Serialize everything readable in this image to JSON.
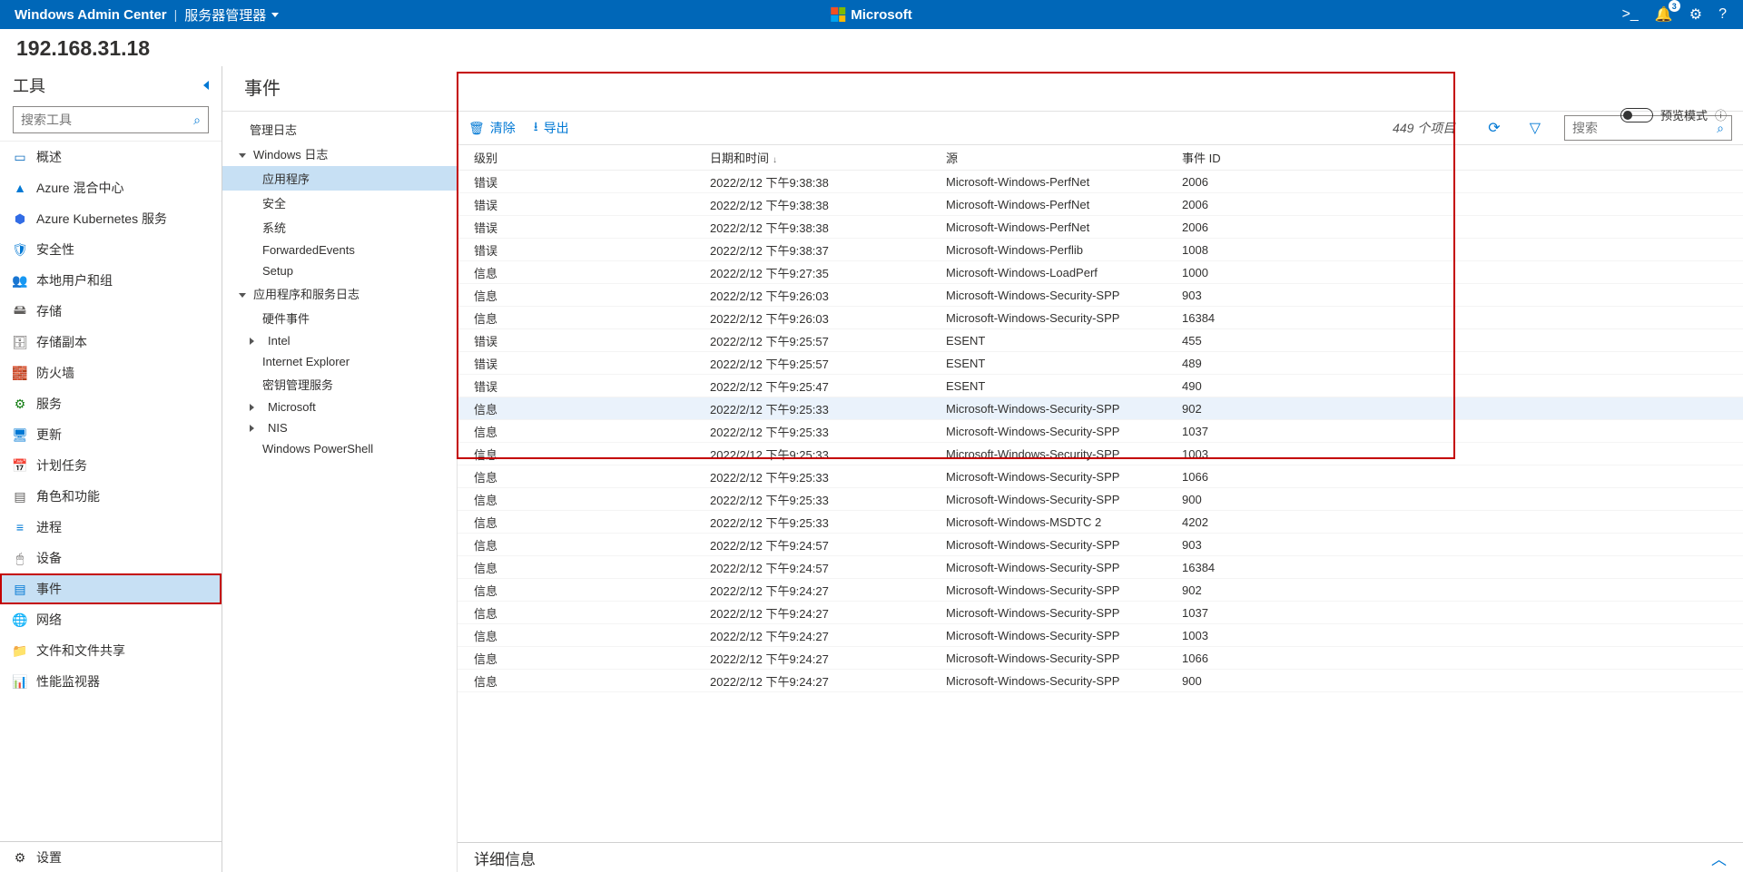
{
  "topbar": {
    "brand": "Windows Admin Center",
    "scope": "服务器管理器",
    "ms": "Microsoft",
    "notif_count": "3"
  },
  "connection": "192.168.31.18",
  "tools": {
    "header": "工具",
    "search_placeholder": "搜索工具",
    "items": [
      {
        "label": "概述",
        "icon": "overview",
        "color": "#106ebe"
      },
      {
        "label": "Azure 混合中心",
        "icon": "azure",
        "color": "#0078d4"
      },
      {
        "label": "Azure Kubernetes 服务",
        "icon": "aks",
        "color": "#326ce5"
      },
      {
        "label": "安全性",
        "icon": "shield",
        "color": "#0078d4"
      },
      {
        "label": "本地用户和组",
        "icon": "users",
        "color": "#d83b01"
      },
      {
        "label": "存储",
        "icon": "storage",
        "color": "#605e5c"
      },
      {
        "label": "存储副本",
        "icon": "replica",
        "color": "#605e5c"
      },
      {
        "label": "防火墙",
        "icon": "firewall",
        "color": "#d13438"
      },
      {
        "label": "服务",
        "icon": "services",
        "color": "#107c10"
      },
      {
        "label": "更新",
        "icon": "update",
        "color": "#0078d4"
      },
      {
        "label": "计划任务",
        "icon": "tasks",
        "color": "#5c2e91"
      },
      {
        "label": "角色和功能",
        "icon": "roles",
        "color": "#605e5c"
      },
      {
        "label": "进程",
        "icon": "process",
        "color": "#0078d4"
      },
      {
        "label": "设备",
        "icon": "devices",
        "color": "#605e5c"
      },
      {
        "label": "事件",
        "icon": "events",
        "color": "#0078d4",
        "selected": true
      },
      {
        "label": "网络",
        "icon": "network",
        "color": "#107c10"
      },
      {
        "label": "文件和文件共享",
        "icon": "files",
        "color": "#ffb900"
      },
      {
        "label": "性能监视器",
        "icon": "perf",
        "color": "#0078d4"
      }
    ],
    "footer": {
      "label": "设置",
      "icon": "gear",
      "color": "#605e5c"
    }
  },
  "main": {
    "title": "事件",
    "preview_label": "预览模式",
    "tree": {
      "root": "管理日志",
      "groups": [
        {
          "label": "Windows 日志",
          "expanded": true,
          "children": [
            {
              "label": "应用程序",
              "selected": true
            },
            {
              "label": "安全"
            },
            {
              "label": "系统"
            },
            {
              "label": "ForwardedEvents"
            },
            {
              "label": "Setup"
            }
          ]
        },
        {
          "label": "应用程序和服务日志",
          "expanded": true,
          "children": [
            {
              "label": "硬件事件"
            },
            {
              "label": "Intel",
              "hasChildren": true
            },
            {
              "label": "Internet Explorer"
            },
            {
              "label": "密钥管理服务"
            },
            {
              "label": "Microsoft",
              "hasChildren": true
            },
            {
              "label": "NIS",
              "hasChildren": true
            },
            {
              "label": "Windows PowerShell"
            }
          ]
        }
      ]
    },
    "cmd": {
      "clear": "清除",
      "export": "导出",
      "items_text": "449 个项目",
      "search_placeholder": "搜索"
    },
    "columns": {
      "level": "级别",
      "datetime": "日期和时间",
      "source": "源",
      "id": "事件 ID"
    },
    "rows": [
      {
        "level": "错误",
        "dt": "2022/2/12 下午9:38:38",
        "src": "Microsoft-Windows-PerfNet",
        "id": "2006"
      },
      {
        "level": "错误",
        "dt": "2022/2/12 下午9:38:38",
        "src": "Microsoft-Windows-PerfNet",
        "id": "2006"
      },
      {
        "level": "错误",
        "dt": "2022/2/12 下午9:38:38",
        "src": "Microsoft-Windows-PerfNet",
        "id": "2006"
      },
      {
        "level": "错误",
        "dt": "2022/2/12 下午9:38:37",
        "src": "Microsoft-Windows-Perflib",
        "id": "1008"
      },
      {
        "level": "信息",
        "dt": "2022/2/12 下午9:27:35",
        "src": "Microsoft-Windows-LoadPerf",
        "id": "1000"
      },
      {
        "level": "信息",
        "dt": "2022/2/12 下午9:26:03",
        "src": "Microsoft-Windows-Security-SPP",
        "id": "903"
      },
      {
        "level": "信息",
        "dt": "2022/2/12 下午9:26:03",
        "src": "Microsoft-Windows-Security-SPP",
        "id": "16384"
      },
      {
        "level": "错误",
        "dt": "2022/2/12 下午9:25:57",
        "src": "ESENT",
        "id": "455"
      },
      {
        "level": "错误",
        "dt": "2022/2/12 下午9:25:57",
        "src": "ESENT",
        "id": "489"
      },
      {
        "level": "错误",
        "dt": "2022/2/12 下午9:25:47",
        "src": "ESENT",
        "id": "490"
      },
      {
        "level": "信息",
        "dt": "2022/2/12 下午9:25:33",
        "src": "Microsoft-Windows-Security-SPP",
        "id": "902",
        "sel": true
      },
      {
        "level": "信息",
        "dt": "2022/2/12 下午9:25:33",
        "src": "Microsoft-Windows-Security-SPP",
        "id": "1037"
      },
      {
        "level": "信息",
        "dt": "2022/2/12 下午9:25:33",
        "src": "Microsoft-Windows-Security-SPP",
        "id": "1003"
      },
      {
        "level": "信息",
        "dt": "2022/2/12 下午9:25:33",
        "src": "Microsoft-Windows-Security-SPP",
        "id": "1066"
      },
      {
        "level": "信息",
        "dt": "2022/2/12 下午9:25:33",
        "src": "Microsoft-Windows-Security-SPP",
        "id": "900"
      },
      {
        "level": "信息",
        "dt": "2022/2/12 下午9:25:33",
        "src": "Microsoft-Windows-MSDTC 2",
        "id": "4202"
      },
      {
        "level": "信息",
        "dt": "2022/2/12 下午9:24:57",
        "src": "Microsoft-Windows-Security-SPP",
        "id": "903"
      },
      {
        "level": "信息",
        "dt": "2022/2/12 下午9:24:57",
        "src": "Microsoft-Windows-Security-SPP",
        "id": "16384"
      },
      {
        "level": "信息",
        "dt": "2022/2/12 下午9:24:27",
        "src": "Microsoft-Windows-Security-SPP",
        "id": "902"
      },
      {
        "level": "信息",
        "dt": "2022/2/12 下午9:24:27",
        "src": "Microsoft-Windows-Security-SPP",
        "id": "1037"
      },
      {
        "level": "信息",
        "dt": "2022/2/12 下午9:24:27",
        "src": "Microsoft-Windows-Security-SPP",
        "id": "1003"
      },
      {
        "level": "信息",
        "dt": "2022/2/12 下午9:24:27",
        "src": "Microsoft-Windows-Security-SPP",
        "id": "1066"
      },
      {
        "level": "信息",
        "dt": "2022/2/12 下午9:24:27",
        "src": "Microsoft-Windows-Security-SPP",
        "id": "900"
      }
    ],
    "detail_title": "详细信息"
  }
}
